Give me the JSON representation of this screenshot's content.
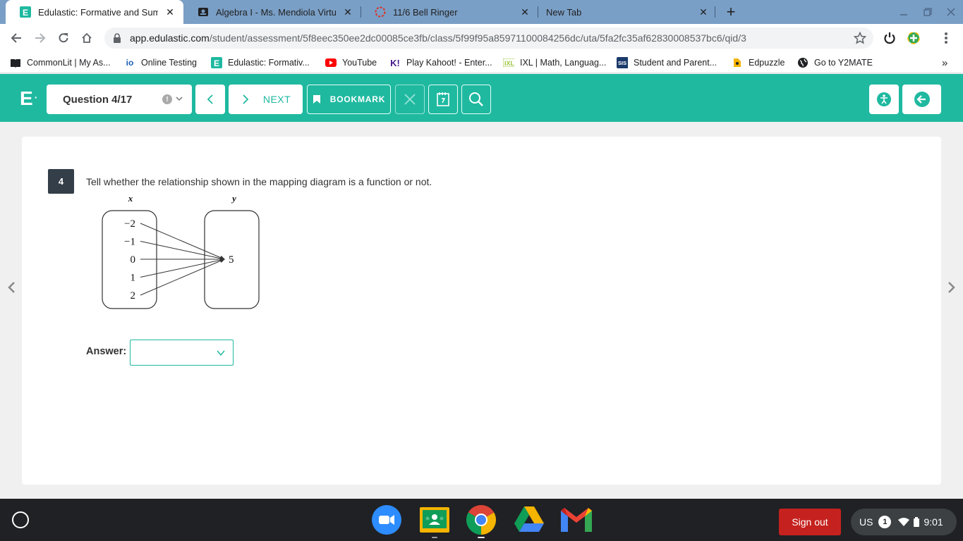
{
  "browser": {
    "tabs": [
      {
        "title": "Edulastic: Formative and Summa",
        "active": true
      },
      {
        "title": "Algebra I - Ms. Mendiola Virtual",
        "active": false
      },
      {
        "title": "11/6 Bell Ringer",
        "active": false
      },
      {
        "title": "New Tab",
        "active": false
      }
    ],
    "url_host": "app.edulastic.com",
    "url_path": "/student/assessment/5f8eec350ee2dc00085ce3fb/class/5f99f95a85971100084256dc/uta/5fa2fc35af62830008537bc6/qid/3",
    "bookmarks": [
      "CommonLit | My As...",
      "Online Testing",
      "Edulastic: Formativ...",
      "YouTube",
      "Play Kahoot! - Enter...",
      "IXL | Math, Languag...",
      "Student and Parent...",
      "Edpuzzle",
      "Go to Y2MATE"
    ],
    "bookmarks_overflow": "»"
  },
  "header": {
    "logo": "E",
    "question_selector": "Question 4/17",
    "next_label": "NEXT",
    "bookmark_label": "BOOKMARK",
    "accent": "#1fb9a0"
  },
  "question": {
    "number": "4",
    "text": "Tell whether the relationship shown in the mapping diagram is a function or not.",
    "diagram": {
      "x_label": "x",
      "y_label": "y",
      "domain": [
        "−2",
        "−1",
        "0",
        "1",
        "2"
      ],
      "range": [
        "5"
      ],
      "mapping": [
        [
          "−2",
          "5"
        ],
        [
          "−1",
          "5"
        ],
        [
          "0",
          "5"
        ],
        [
          "1",
          "5"
        ],
        [
          "2",
          "5"
        ]
      ]
    },
    "answer_label": "Answer:",
    "answer_value": ""
  },
  "shelf": {
    "apps": [
      "zoom-icon",
      "google-classroom-icon",
      "chrome-icon",
      "google-drive-icon",
      "gmail-icon"
    ],
    "sign_out": "Sign out",
    "locale": "US",
    "notifications": "1",
    "time": "9:01"
  }
}
